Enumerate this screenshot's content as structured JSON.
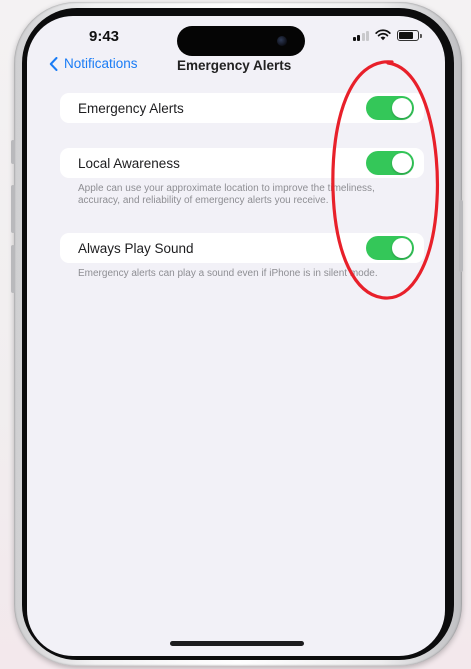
{
  "status_bar": {
    "time": "9:43"
  },
  "nav": {
    "back_label": "Notifications",
    "title": "Emergency Alerts"
  },
  "settings": [
    {
      "label": "Emergency Alerts",
      "toggle_on": true,
      "footnote": ""
    },
    {
      "label": "Local Awareness",
      "toggle_on": true,
      "footnote": "Apple can use your approximate location to improve the timeliness, accuracy, and reliability of emergency alerts you receive."
    },
    {
      "label": "Always Play Sound",
      "toggle_on": true,
      "footnote": "Emergency alerts can play a sound even if iPhone is in silent mode."
    }
  ],
  "colors": {
    "accent_blue": "#1a7cf5",
    "toggle_green": "#34c759",
    "annotation_red": "#e8202a",
    "screen_background": "#f2f1f7"
  },
  "icons": {
    "back": "chevron-left-icon",
    "signal": "cellular-signal-icon",
    "wifi": "wifi-icon",
    "battery": "battery-icon"
  },
  "annotation": {
    "shape": "ellipse",
    "highlights": "toggle switches"
  }
}
